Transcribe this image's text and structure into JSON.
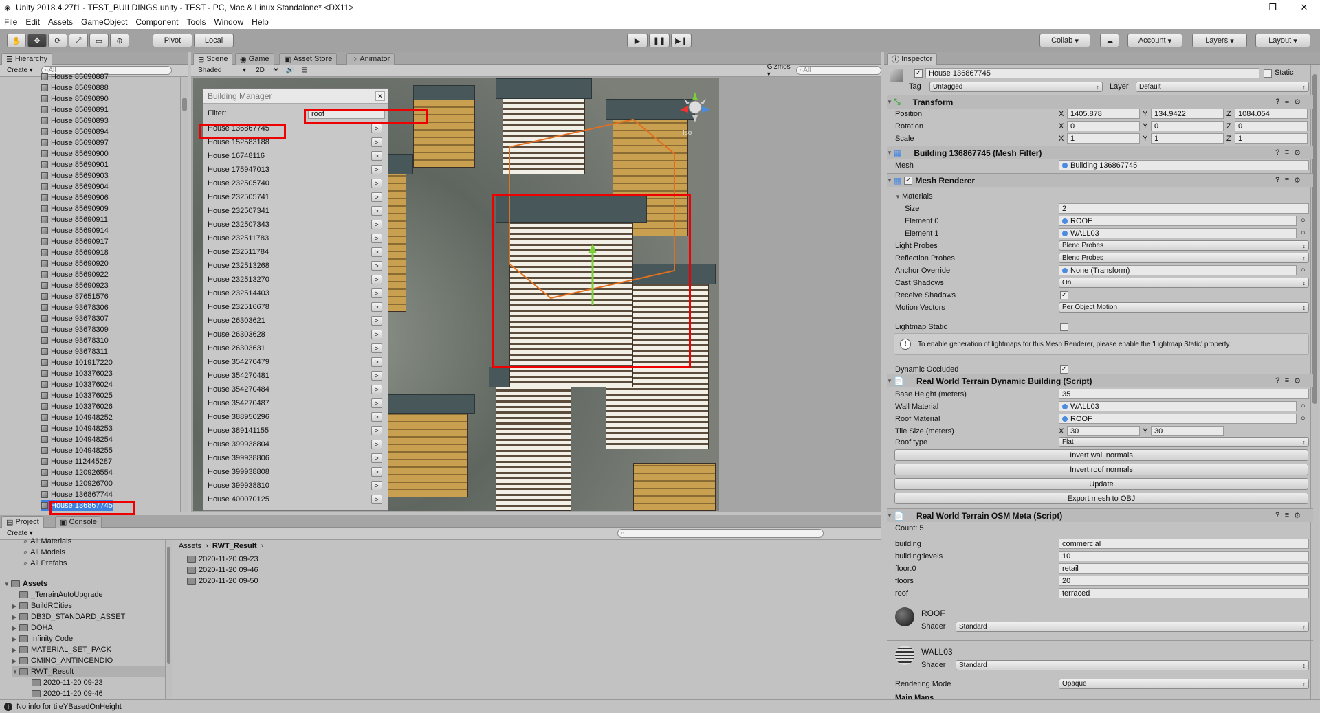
{
  "window": {
    "title": "Unity 2018.4.27f1 - TEST_BUILDINGS.unity - TEST - PC, Mac & Linux Standalone* <DX11>"
  },
  "menu": [
    "File",
    "Edit",
    "Assets",
    "GameObject",
    "Component",
    "Tools",
    "Window",
    "Help"
  ],
  "toolbar": {
    "pivot": "Pivot",
    "local": "Local",
    "collab": "Collab",
    "account": "Account",
    "layers": "Layers",
    "layout": "Layout"
  },
  "hierarchy": {
    "tab": "Hierarchy",
    "create": "Create",
    "search": "All",
    "items": [
      "House 85690887",
      "House 85690888",
      "House 85690890",
      "House 85690891",
      "House 85690893",
      "House 85690894",
      "House 85690897",
      "House 85690900",
      "House 85690901",
      "House 85690903",
      "House 85690904",
      "House 85690906",
      "House 85690909",
      "House 85690911",
      "House 85690914",
      "House 85690917",
      "House 85690918",
      "House 85690920",
      "House 85690922",
      "House 85690923",
      "House 87651576",
      "House 93678306",
      "House 93678307",
      "House 93678309",
      "House 93678310",
      "House 93678311",
      "House 101917220",
      "House 103376023",
      "House 103376024",
      "House 103376025",
      "House 103376026",
      "House 104948252",
      "House 104948253",
      "House 104948254",
      "House 104948255",
      "House 112445287",
      "House 120926554",
      "House 120926700",
      "House 136867744",
      "House 136867745"
    ]
  },
  "scene": {
    "tabs": [
      "Scene",
      "Game",
      "Asset Store",
      "Animator"
    ],
    "shaded": "Shaded",
    "mode2d": "2D",
    "gizmos": "Gizmos",
    "search": "All",
    "persp": "Iso"
  },
  "building_manager": {
    "title": "Building Manager",
    "filter_label": "Filter:",
    "filter_value": "roof",
    "items": [
      "House 136867745",
      "House 152583188",
      "House 16748116",
      "House 175947013",
      "House 232505740",
      "House 232505741",
      "House 232507341",
      "House 232507343",
      "House 232511783",
      "House 232511784",
      "House 232513268",
      "House 232513270",
      "House 232514403",
      "House 232516678",
      "House 26303621",
      "House 26303628",
      "House 26303631",
      "House 354270479",
      "House 354270481",
      "House 354270484",
      "House 354270487",
      "House 388950296",
      "House 389141155",
      "House 399938804",
      "House 399938806",
      "House 399938808",
      "House 399938810",
      "House 400070125"
    ],
    "go": ">"
  },
  "project": {
    "tabs": [
      "Project",
      "Console"
    ],
    "create": "Create",
    "favorites": [
      "All Materials",
      "All Models",
      "All Prefabs"
    ],
    "assets_label": "Assets",
    "folders": [
      "_TerrainAutoUpgrade",
      "BuildRCities",
      "DB3D_STANDARD_ASSET",
      "DOHA",
      "Infinity Code",
      "MATERIAL_SET_PACK",
      "OMINO_ANTINCENDIO",
      "RWT_Result"
    ],
    "subfolders": [
      "2020-11-20 09-23",
      "2020-11-20 09-46"
    ],
    "breadcrumb": [
      "Assets",
      "RWT_Result"
    ],
    "content": [
      "2020-11-20 09-23",
      "2020-11-20 09-46",
      "2020-11-20 09-50"
    ]
  },
  "inspector": {
    "tab": "Inspector",
    "object_name": "House 136867745",
    "static": "Static",
    "tag_label": "Tag",
    "tag": "Untagged",
    "layer_label": "Layer",
    "layer": "Default",
    "transform": {
      "title": "Transform",
      "position": {
        "label": "Position",
        "x": "1405.878",
        "y": "134.9422",
        "z": "1084.054"
      },
      "rotation": {
        "label": "Rotation",
        "x": "0",
        "y": "0",
        "z": "0"
      },
      "scale": {
        "label": "Scale",
        "x": "1",
        "y": "1",
        "z": "1"
      }
    },
    "mesh_filter": {
      "title": "Building 136867745 (Mesh Filter)",
      "mesh_label": "Mesh",
      "mesh": "Building 136867745"
    },
    "mesh_renderer": {
      "title": "Mesh Renderer",
      "materials": "Materials",
      "size_label": "Size",
      "size": "2",
      "el0_label": "Element 0",
      "el0": "ROOF",
      "el1_label": "Element 1",
      "el1": "WALL03",
      "light_probes_label": "Light Probes",
      "light_probes": "Blend Probes",
      "reflection_probes_label": "Reflection Probes",
      "reflection_probes": "Blend Probes",
      "anchor_label": "Anchor Override",
      "anchor": "None (Transform)",
      "cast_label": "Cast Shadows",
      "cast": "On",
      "receive_label": "Receive Shadows",
      "motion_label": "Motion Vectors",
      "motion": "Per Object Motion",
      "lightmap_label": "Lightmap Static",
      "info": "To enable generation of lightmaps for this Mesh Renderer, please enable the 'Lightmap Static' property.",
      "dynamic_label": "Dynamic Occluded"
    },
    "rwt_building": {
      "title": "Real World Terrain Dynamic Building (Script)",
      "base_label": "Base Height (meters)",
      "base": "35",
      "wall_label": "Wall Material",
      "wall": "WALL03",
      "roof_label": "Roof Material",
      "roof": "ROOF",
      "tile_label": "Tile Size (meters)",
      "tile_x": "30",
      "tile_y": "30",
      "rooftype_label": "Roof type",
      "rooftype": "Flat",
      "btn_invert_wall": "Invert wall normals",
      "btn_invert_roof": "Invert roof normals",
      "btn_update": "Update",
      "btn_export": "Export mesh to OBJ"
    },
    "osm_meta": {
      "title": "Real World Terrain OSM Meta (Script)",
      "count": "Count: 5",
      "rows": [
        [
          "building",
          "commercial"
        ],
        [
          "building:levels",
          "10"
        ],
        [
          "floor:0",
          "retail"
        ],
        [
          "floors",
          "20"
        ],
        [
          "roof",
          "terraced"
        ]
      ]
    },
    "mat_roof": {
      "name": "ROOF",
      "shader_label": "Shader",
      "shader": "Standard"
    },
    "mat_wall": {
      "name": "WALL03",
      "shader_label": "Shader",
      "shader": "Standard"
    },
    "rendering_label": "Rendering Mode",
    "rendering": "Opaque",
    "main_maps": "Main Maps"
  },
  "status": {
    "text": "No info for tileYBasedOnHeight"
  },
  "colors": {
    "highlight": "#e00000",
    "selection_orange": "#e07020"
  }
}
